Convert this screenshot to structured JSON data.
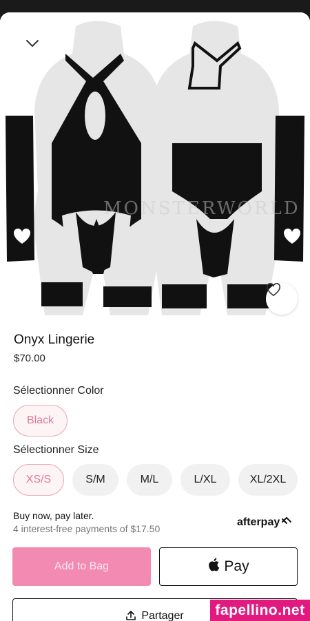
{
  "product": {
    "name": "Onyx Lingerie",
    "price": "$70.00",
    "watermark": "MONSTERWORLD"
  },
  "color": {
    "label": "Sélectionner Color",
    "options": [
      "Black"
    ],
    "selected": "Black"
  },
  "size": {
    "label": "Sélectionner Size",
    "options": [
      "XS/S",
      "S/M",
      "M/L",
      "L/XL",
      "XL/2XL"
    ],
    "selected": "XS/S"
  },
  "bnpl": {
    "line1": "Buy now, pay later.",
    "line2": "4 interest-free payments of $17.50",
    "provider": "afterpay"
  },
  "actions": {
    "add_to_bag": "Add to Bag",
    "pay": "Pay",
    "share": "Partager"
  },
  "badge": "fapellino.net",
  "icons": {
    "collapse": "chevron-down-icon",
    "favorite": "heart-outline-icon",
    "apple": "apple-icon",
    "share": "share-arrow-icon",
    "afterpay": "afterpay-arrows-icon"
  },
  "colors": {
    "accent_pink": "#f38ab2",
    "selected_text": "#e07a93",
    "badge": "#e2197f"
  }
}
